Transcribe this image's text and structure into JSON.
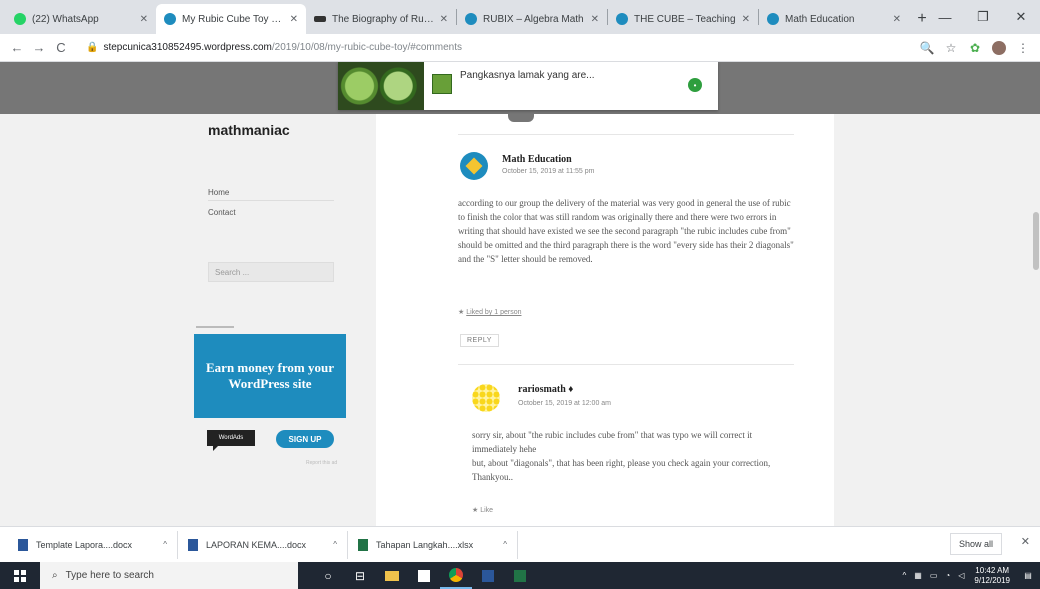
{
  "browser": {
    "tabs": [
      {
        "label": "(22) WhatsApp",
        "color": "#25d366",
        "active": false
      },
      {
        "label": "My Rubic Cube Toy — WordPress",
        "color": "#1e8cbe",
        "active": true
      },
      {
        "label": "The Biography of Rubik",
        "color": "#333333",
        "active": false
      },
      {
        "label": "RUBIX – Algebra Math",
        "color": "#1e8cbe",
        "active": false
      },
      {
        "label": "THE CUBE – Teaching",
        "color": "#1e8cbe",
        "active": false
      },
      {
        "label": "Math Education",
        "color": "#1e8cbe",
        "active": false
      }
    ],
    "new_tab": "+",
    "window_controls": {
      "minimize": "—",
      "maximize": "❐",
      "close": "✕"
    },
    "nav": {
      "back": "←",
      "forward": "→",
      "reload": "C"
    },
    "url_domain": "stepcunica310852495.wordpress.com",
    "url_path": "/2019/10/08/my-rubic-cube-toy/#comments",
    "toolbar_icons": {
      "zoom": "🔍",
      "star": "☆",
      "extension": "✿",
      "menu": "⋮"
    }
  },
  "notification": {
    "text": "Pangkasnya lamak yang are...",
    "badge": "•"
  },
  "sidebar": {
    "site_title": "mathmaniac",
    "links": [
      "Home",
      "Contact"
    ],
    "search_placeholder": "Search ...",
    "ad_text": "Earn money from your WordPress site",
    "ad_label": "WordAds",
    "signup_label": "SIGN UP",
    "report_label": "Report this ad"
  },
  "comments": [
    {
      "author": "Math Education",
      "date": "October 15, 2019 at 11:55 pm",
      "body": "according to our group the delivery of the material was very good in general the use of rubic to finish the color that was still random was originally there and there were two errors in writing that should have existed we see the second paragraph \"the rubic includes cube from\" should be omitted and the third paragraph there is the word \"every side has their 2 diagonals\" and the \"S\" letter should be removed.",
      "like": "Liked by 1 person",
      "reply": "REPLY"
    },
    {
      "author": "rariosmath ♦",
      "date": "October 15, 2019 at 12:00 am",
      "body": "sorry sir, about \"the rubic includes cube from\" that was typo we will correct it immediately hehe\nbut, about \"diagonals\", that has been right, please you check again your correction, Thankyou..",
      "like": "Like"
    }
  ],
  "downloads": {
    "items": [
      {
        "name": "Template Lapora....docx"
      },
      {
        "name": "LAPORAN KEMA....docx"
      },
      {
        "name": "Tahapan Langkah....xlsx"
      }
    ],
    "show_all": "Show all",
    "close": "✕"
  },
  "taskbar": {
    "search_placeholder": "Type here to search",
    "clock_time": "10:42 AM",
    "clock_date": "9/12/2019"
  }
}
